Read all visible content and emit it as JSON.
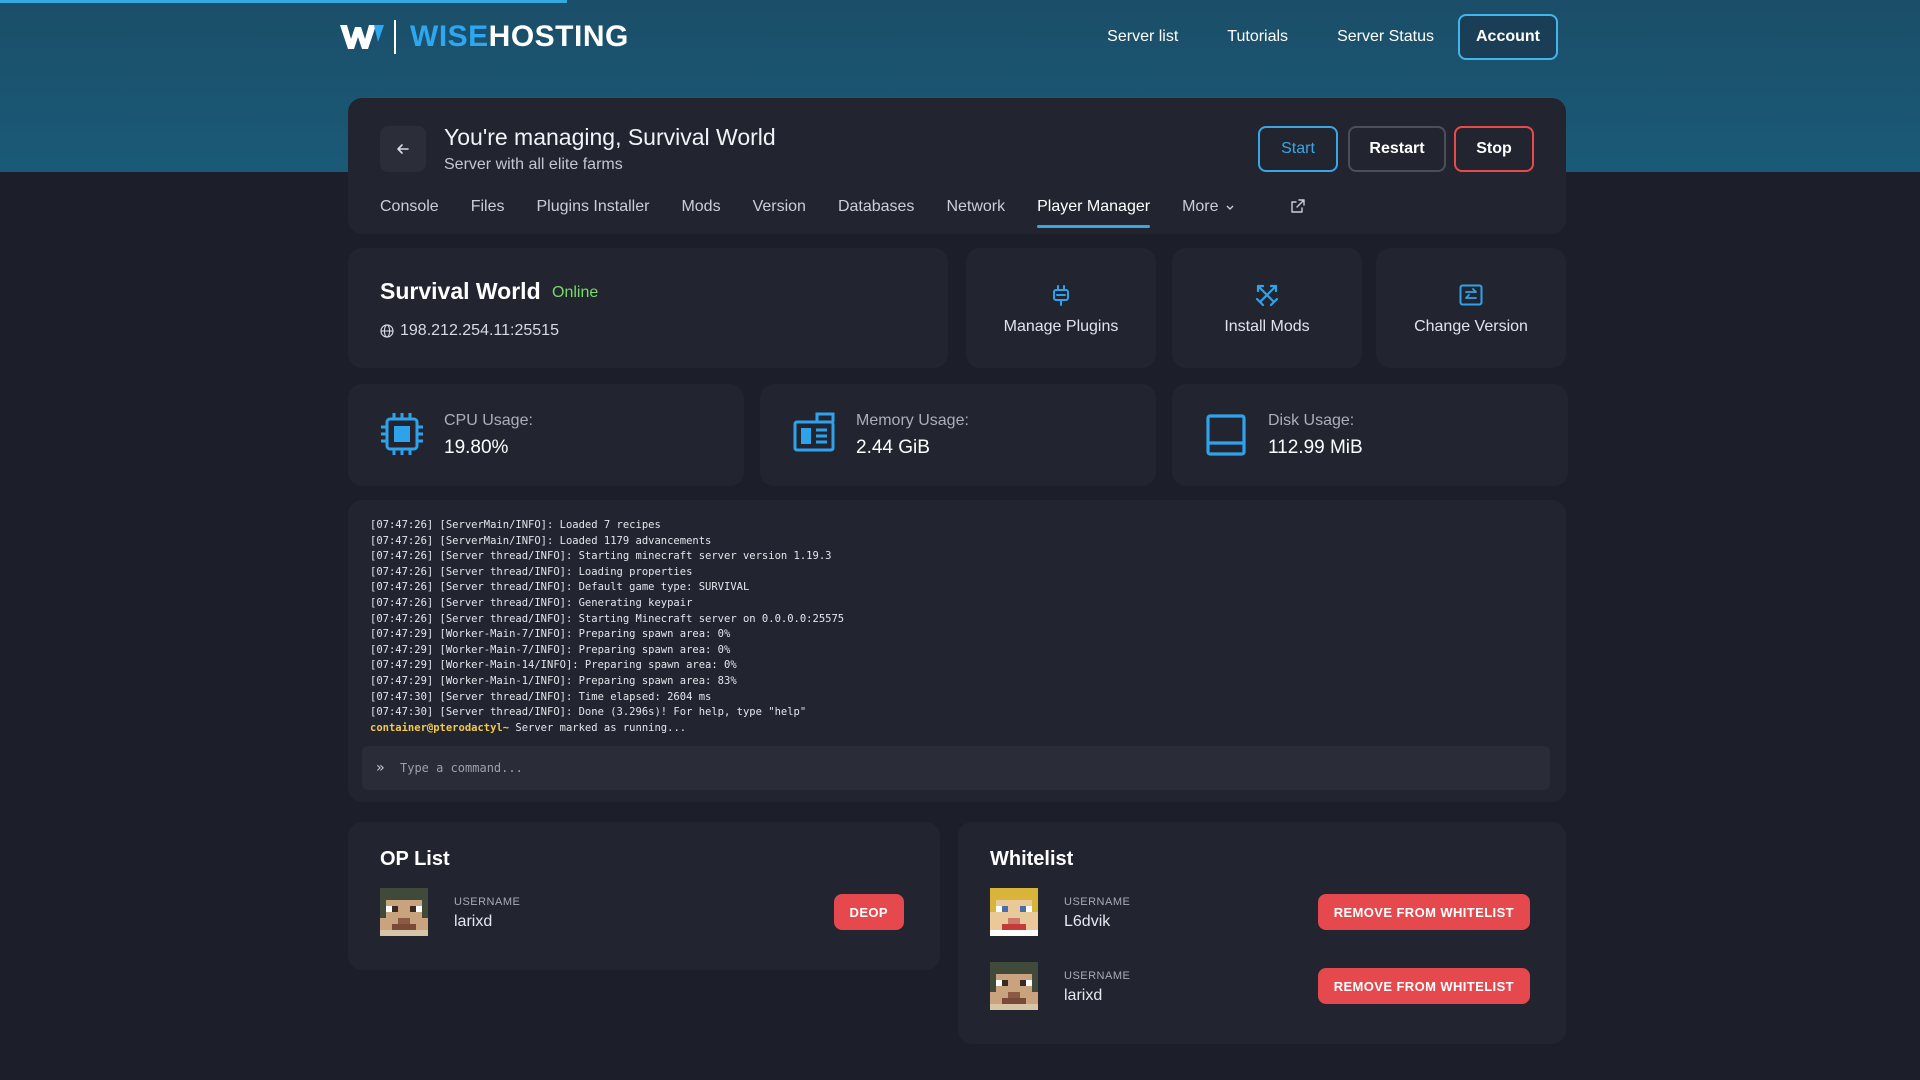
{
  "brand": {
    "wise": "WISE",
    "hosting": "HOSTING",
    "accent": "#2fa7f0"
  },
  "nav": {
    "links": [
      "Server list",
      "Tutorials",
      "Server Status"
    ],
    "account": "Account"
  },
  "manage": {
    "title": "You're managing, Survival World",
    "subtitle": "Server with all elite farms",
    "controls": {
      "start": "Start",
      "restart": "Restart",
      "stop": "Stop"
    },
    "tabs": [
      "Console",
      "Files",
      "Plugins Installer",
      "Mods",
      "Version",
      "Databases",
      "Network",
      "Player Manager",
      "More"
    ],
    "active_tab": "Player Manager"
  },
  "server": {
    "name": "Survival World",
    "status": "Online",
    "status_color": "#7ad96a",
    "ip": "198.212.254.11:25515"
  },
  "quick_actions": [
    {
      "label": "Manage Plugins",
      "icon": "plug-icon"
    },
    {
      "label": "Install Mods",
      "icon": "crossed-swords-icon"
    },
    {
      "label": "Change Version",
      "icon": "swap-arrows-icon"
    }
  ],
  "usage": {
    "cpu": {
      "label": "CPU Usage:",
      "value": "19.80%",
      "icon": "cpu-icon"
    },
    "memory": {
      "label": "Memory Usage:",
      "value": "2.44 GiB",
      "icon": "memory-icon"
    },
    "disk": {
      "label": "Disk Usage:",
      "value": "112.99 MiB",
      "icon": "disk-icon"
    }
  },
  "console": {
    "lines": [
      "[07:47:26] [ServerMain/INFO]: Loaded 7 recipes",
      "[07:47:26] [ServerMain/INFO]: Loaded 1179 advancements",
      "[07:47:26] [Server thread/INFO]: Starting minecraft server version 1.19.3",
      "[07:47:26] [Server thread/INFO]: Loading properties",
      "[07:47:26] [Server thread/INFO]: Default game type: SURVIVAL",
      "[07:47:26] [Server thread/INFO]: Generating keypair",
      "[07:47:26] [Server thread/INFO]: Starting Minecraft server on 0.0.0.0:25575",
      "[07:47:29] [Worker-Main-7/INFO]: Preparing spawn area: 0%",
      "[07:47:29] [Worker-Main-7/INFO]: Preparing spawn area: 0%",
      "[07:47:29] [Worker-Main-14/INFO]: Preparing spawn area: 0%",
      "[07:47:29] [Worker-Main-1/INFO]: Preparing spawn area: 83%",
      "[07:47:30] [Server thread/INFO]: Time elapsed: 2604 ms",
      "[07:47:30] [Server thread/INFO]: Done (3.296s)! For help, type \"help\""
    ],
    "prompt_user": "container@pterodactyl~",
    "prompt_msg": " Server marked as running...",
    "input_placeholder": "Type a command..."
  },
  "op_list": {
    "title": "OP List",
    "players": [
      {
        "caption": "USERNAME",
        "name": "larixd",
        "action": "DEOP"
      }
    ]
  },
  "whitelist": {
    "title": "Whitelist",
    "players": [
      {
        "caption": "USERNAME",
        "name": "L6dvik",
        "action": "REMOVE FROM WHITELIST"
      },
      {
        "caption": "USERNAME",
        "name": "larixd",
        "action": "REMOVE FROM WHITELIST"
      }
    ]
  }
}
